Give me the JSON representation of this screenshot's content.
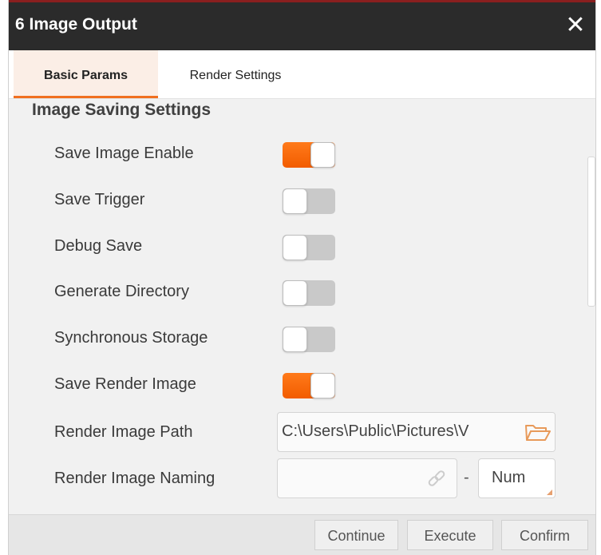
{
  "window": {
    "title": "6 Image Output",
    "close_icon": "close-icon"
  },
  "tabs": [
    {
      "label": "Basic Params",
      "active": true
    },
    {
      "label": "Render Settings",
      "active": false
    }
  ],
  "section": {
    "title": "Image Saving Settings"
  },
  "settings": [
    {
      "label": "Save Image Enable",
      "enabled": true
    },
    {
      "label": "Save Trigger",
      "enabled": false
    },
    {
      "label": "Debug Save",
      "enabled": false
    },
    {
      "label": "Generate Directory",
      "enabled": false
    },
    {
      "label": "Synchronous Storage",
      "enabled": false
    },
    {
      "label": "Save Render Image",
      "enabled": true
    }
  ],
  "render_image_path": {
    "label": "Render Image Path",
    "value": "C:\\Users\\Public\\Pictures\\V",
    "icon": "folder-icon"
  },
  "render_image_naming": {
    "label": "Render Image Naming",
    "value": "",
    "icon": "link-icon",
    "separator": "-",
    "suffix_value": "Num"
  },
  "footer": {
    "continue_label": "Continue",
    "execute_label": "Execute",
    "confirm_label": "Confirm"
  },
  "colors": {
    "accent": "#f25c00",
    "titlebar": "#2b2b2b",
    "toggle_off": "#c9c9c9"
  }
}
